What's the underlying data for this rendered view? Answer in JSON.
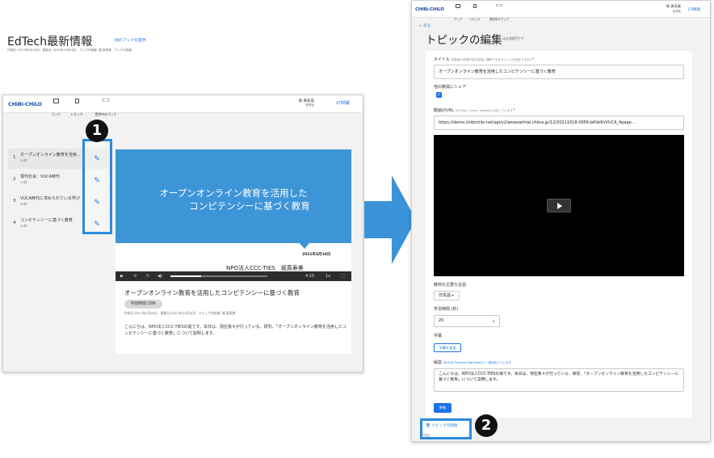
{
  "left": {
    "app": {
      "logo": "CHiBi-CHiLO",
      "nav": [
        {
          "label": "ブック",
          "icon": "book-icon"
        },
        {
          "label": "トピック",
          "icon": "topic-icon"
        },
        {
          "label": "提供中のブック",
          "icon": "link-icon"
        }
      ],
      "user_name": "堀 真寿美",
      "user_role": "管理者",
      "lti_label": "LTI情報"
    },
    "book_title": "EdTech最新情報",
    "book_meta": "作成日: 2017年2月16日　更新日: 2021年10月18日　ブック作成者: 堀 真寿美　ブックの詳細",
    "share_link": "他のブックを提供",
    "topics": [
      {
        "num": "1",
        "title": "オープンオンライン教育を活用…",
        "duration": "20秒"
      },
      {
        "num": "2",
        "title": "現代社会：VUCA時代",
        "duration": "13秒"
      },
      {
        "num": "3",
        "title": "VUCA時代に求められている学び",
        "duration": "30秒"
      },
      {
        "num": "4",
        "title": "コンピテンシーに基づく教育",
        "duration": "43秒"
      }
    ],
    "slide": {
      "title_line1": "オープンオンライン教育を活用した",
      "title_line2": "コンピテンシーに基づく教育",
      "date": "2021年3月18日",
      "org": "NPO法人CCC-TIES　堀真寿美"
    },
    "player": {
      "time": "4:15",
      "speed": "1x"
    },
    "video_title": "オープンオンライン教育を活用したコンピテンシーに基づく教育",
    "duration_chip": "学習時間 20秒",
    "video_dates": "作成日:2017年2月16日　更新日:2021年10月18日　トピック作成者: 堀 真寿美",
    "description": "こんにちは、NPO法人CCC-TIESの堀です。本日は、現在我々が行っている、研究、「オープンオンライン教育を活用したコンピテンシーに基づく教育」について説明します。",
    "badge": "1"
  },
  "right": {
    "app": {
      "logo": "CHiBi-CHiLO",
      "nav": [
        {
          "label": "ブック",
          "icon": "book-icon"
        },
        {
          "label": "トピック",
          "icon": "topic-icon"
        },
        {
          "label": "提供中のブック",
          "icon": "link-icon"
        }
      ],
      "user_name": "堀 真寿美",
      "user_role": "管理者",
      "lti_label": "LTI情報"
    },
    "back": "← 戻る",
    "heading": "トピックの編集",
    "required_note": "* は必須項目です",
    "title_label": "タイトル",
    "title_hint": "学習者が学習内容を容易に理解できるタイトルを設定できます",
    "title_value": "オープンオンライン教育を活用したコンピテンシーに基づく教育",
    "share_label": "他の教員にシェア",
    "url_label": "動画のURL",
    "url_hint": "YouTube, Vimeo, Wowzaに対応しています",
    "url_value": "https://demo.chibichilo.net/api/v2/wowza/trial.chilos.jp/12/20211018-0956-b6Vo6i/VUCA_4page…",
    "lang_label": "教材の主要な言語",
    "lang_value": "日本語",
    "time_label": "学習時間 (秒)",
    "time_value": "20",
    "subtitle_label": "字幕",
    "subtitle_button": "字幕を追加",
    "desc_label": "解説",
    "desc_hint": "GitHub Flavored Markdownに一部対応しています",
    "desc_value": "こんにちは、NPO法人CCC-TIESの堀です。本日は、現在我々が行っている、研究、「オープンオンライン教育を活用したコンピテンシーに基づく教育」について説明します。",
    "update_button": "更新",
    "delete_button": "トピックを削除",
    "footer": "作成日",
    "badge": "2"
  },
  "colors": {
    "accent": "#1a73e8",
    "highlight_border": "#2b8be0",
    "slide_blue": "#3d95d8",
    "arrow": "#3a93d9"
  }
}
